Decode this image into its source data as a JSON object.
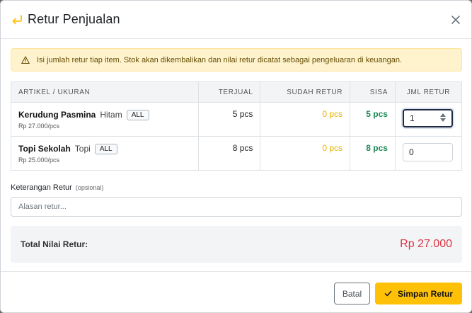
{
  "modal": {
    "title": "Retur Penjualan",
    "title_icon": "return-arrow-icon",
    "close_icon": "close-icon"
  },
  "alert": {
    "icon": "warning-icon",
    "text": "Isi jumlah retur tiap item. Stok akan dikembalikan dan nilai retur dicatat sebagai pengeluaran di keuangan."
  },
  "table": {
    "headers": [
      "ARTIKEL / UKURAN",
      "TERJUAL",
      "SUDAH RETUR",
      "SISA",
      "JML RETUR"
    ],
    "rows": [
      {
        "name": "Kerudung Pasmina",
        "color": "Hitam",
        "size": "ALL",
        "price": "Rp 27.000/pcs",
        "sold": "5 pcs",
        "returned": "0 pcs",
        "remaining": "5 pcs",
        "qty": "1"
      },
      {
        "name": "Topi Sekolah",
        "color": "Topi",
        "size": "ALL",
        "price": "Rp 25.000/pcs",
        "sold": "8 pcs",
        "returned": "0 pcs",
        "remaining": "8 pcs",
        "qty": "0"
      }
    ]
  },
  "notes": {
    "label": "Keterangan Retur",
    "optional": "(opsional)",
    "placeholder": "Alasan retur..."
  },
  "total": {
    "label": "Total Nilai Retur:",
    "value": "Rp 27.000"
  },
  "buttons": {
    "cancel": "Batal",
    "save": "Simpan Retur",
    "save_icon": "check-icon"
  },
  "colors": {
    "accent": "#ffc107",
    "returned": "#e5b100",
    "remaining": "#198754",
    "total": "#dc3545",
    "alert_bg": "#fff3cd"
  }
}
